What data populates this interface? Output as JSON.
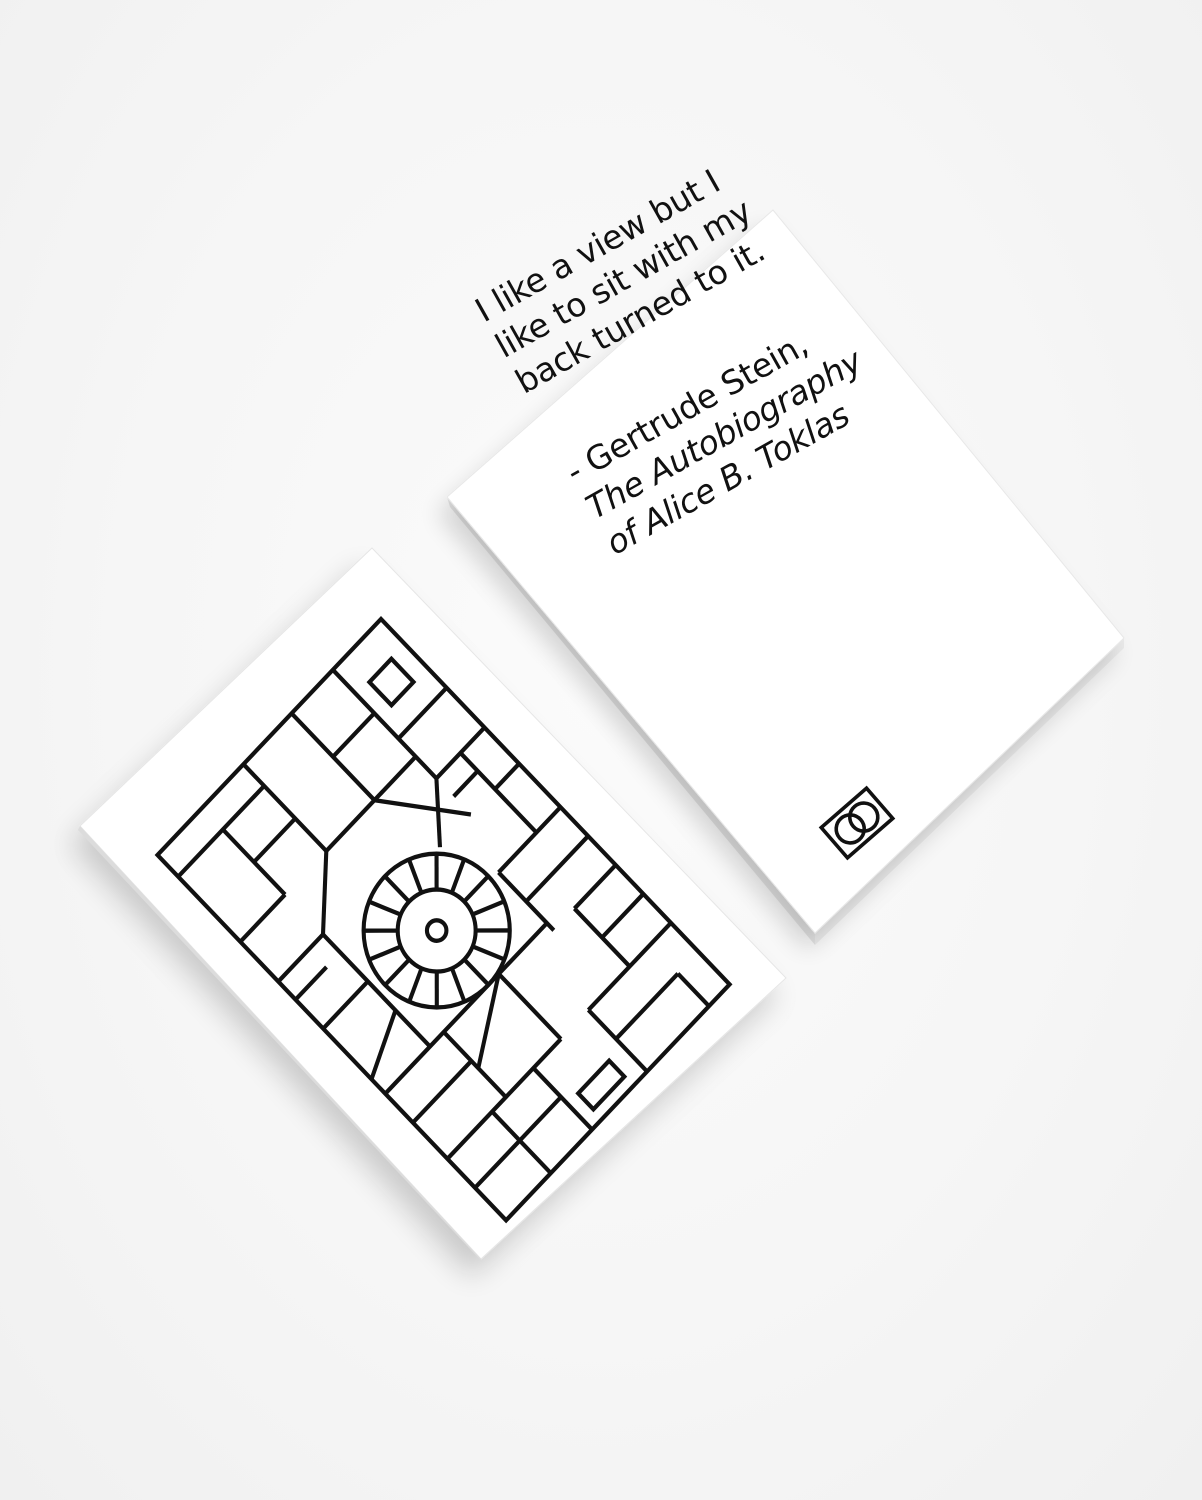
{
  "quote_card": {
    "quote_lines": [
      "I like a view but I",
      "like to sit with my",
      "back turned to it."
    ],
    "attribution_author": "- Gertrude Stein,",
    "attribution_work_lines": [
      "The Autobiography",
      "of Alice B. Toklas"
    ],
    "logo_icon": "interlocking-circles-logo-icon"
  },
  "pattern_card": {
    "icon": "geometric-line-art-illustration"
  },
  "colors": {
    "background": "#f7f7f7",
    "card": "#ffffff",
    "ink": "#111111",
    "card_edge": "#e4e4e4"
  }
}
